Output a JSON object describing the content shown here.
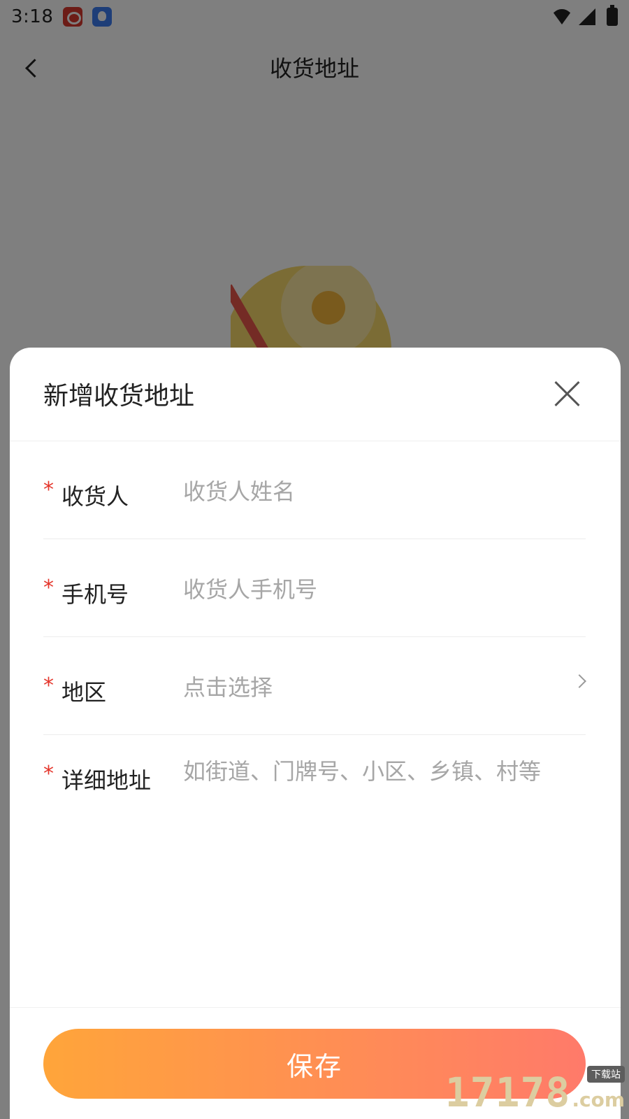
{
  "status_bar": {
    "time": "3:18",
    "left_icons": [
      "weibo-icon",
      "bird-app-icon"
    ],
    "right_icons": [
      "wifi-icon",
      "cellular-icon",
      "battery-charging-icon"
    ]
  },
  "navbar": {
    "title": "收货地址",
    "back_icon": "back-arrow-icon"
  },
  "sheet": {
    "title": "新增收货地址",
    "close_icon": "close-icon",
    "fields": [
      {
        "required_mark": "*",
        "label": "收货人",
        "placeholder": "收货人姓名"
      },
      {
        "required_mark": "*",
        "label": "手机号",
        "placeholder": "收货人手机号"
      },
      {
        "required_mark": "*",
        "label": "地区",
        "placeholder": "点击选择"
      },
      {
        "required_mark": "*",
        "label": "详细地址",
        "placeholder": "如街道、门牌号、小区、乡镇、村等"
      }
    ],
    "save_label": "保存"
  },
  "watermark": {
    "numbers": "17178",
    "domain": ".com",
    "tag": "下载站"
  },
  "colors": {
    "required": "#e4352b",
    "button_gradient_start": "#ffa53a",
    "button_gradient_end": "#ff7a6a",
    "overlay": "rgba(0,0,0,0.5)"
  }
}
